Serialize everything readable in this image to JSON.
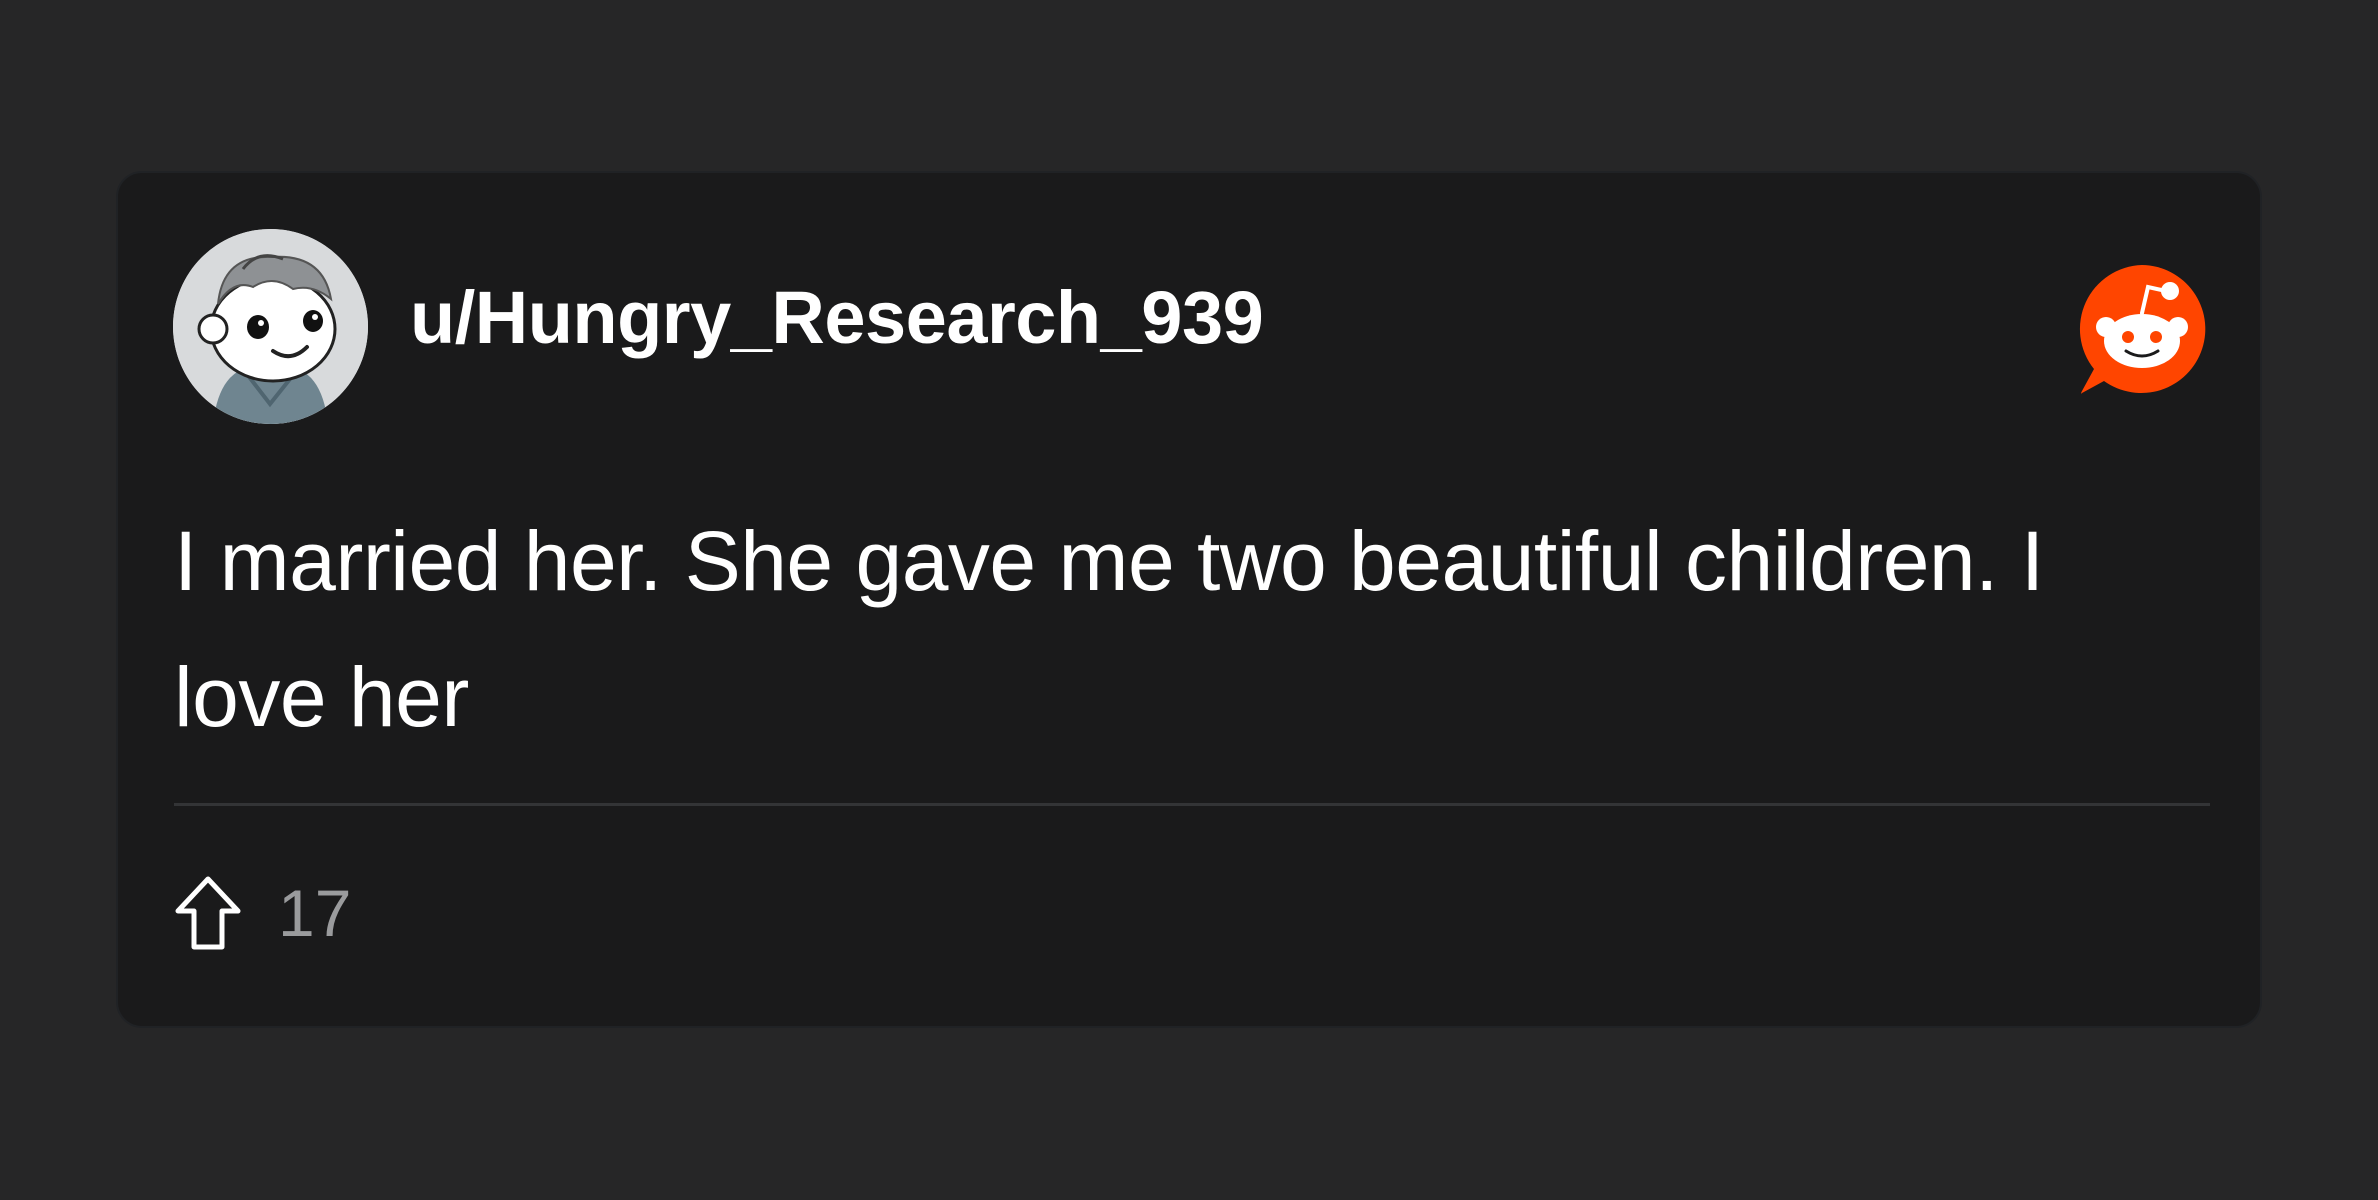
{
  "post": {
    "username": "u/Hungry_Research_939",
    "body": "I married her. She gave me two beautiful children. I love her",
    "upvotes": "17"
  },
  "icons": {
    "avatar": "snoo-avatar",
    "brand": "reddit-logo-icon",
    "upvote": "upvote-arrow-icon"
  },
  "colors": {
    "background": "#262627",
    "card": "#1a1a1b",
    "brand_accent": "#ff4500",
    "text_primary": "#ffffff",
    "text_secondary": "#9a9b9d"
  }
}
